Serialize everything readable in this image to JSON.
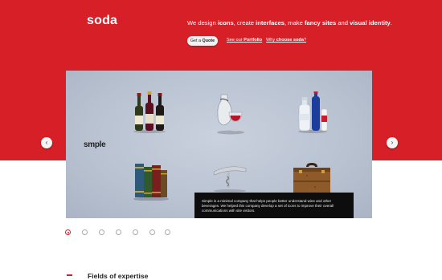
{
  "header": {
    "logo": "soda",
    "tagline": {
      "t1": "We design ",
      "icons": "icons",
      "t2": ", create ",
      "interfaces": "interfaces",
      "t3": ", make ",
      "fancy_sites": "fancy sites",
      "t4": " and ",
      "visual_identity": "visual identity",
      "t5": "."
    },
    "quote_button": {
      "prefix": "Get a ",
      "bold": "Quote"
    },
    "portfolio_link": {
      "prefix": "See our ",
      "bold": "Portfolio"
    },
    "why_link": {
      "prefix": "Why ",
      "bold": "choose soda",
      "suffix": "?"
    }
  },
  "slider": {
    "title": "smple",
    "caption": "Simple is a minimal company that helps people better understand wine and other beverages. We helped this company develop a set of icons to improve their overall communications with site visitors.",
    "prev_arrow": "‹",
    "next_arrow": "›",
    "icons": [
      "wine-bottles-icon",
      "wine-glass-icon",
      "water-bottles-icon",
      "books-icon",
      "corkscrew-icon",
      "briefcase-icon"
    ],
    "active_slide": 1,
    "total_slides": 7
  },
  "sections": {
    "fields_title": "Fields of expertise"
  },
  "colors": {
    "brand_red": "#d71f28",
    "caption_bg": "#0d0d0d",
    "slider_bg": "#c3cbd8"
  }
}
